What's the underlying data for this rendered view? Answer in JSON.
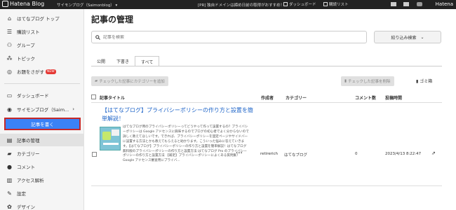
{
  "topbar": {
    "logo": "Hatena Blog",
    "blog_name": "サイモンブログ（Saimonblog） ▾",
    "promo": "[PR] 独自ドメインは締め日前の取得がおすすめ！",
    "dashboard": "ダッシュボード",
    "reading_list": "購読リスト",
    "brand": "Hatena"
  },
  "sidebar": {
    "items": [
      {
        "label": "はてなブログ トップ",
        "icon": "house-icon"
      },
      {
        "label": "購読リスト",
        "icon": "list-icon"
      },
      {
        "label": "グループ",
        "icon": "group-icon"
      },
      {
        "label": "トピック",
        "icon": "topic-icon"
      },
      {
        "label": "お題をさがす",
        "icon": "search-topic-icon",
        "badge": "NEW"
      }
    ],
    "dashboard": "ダッシュボード",
    "blog_selector": "サイモンブログ（Saim...",
    "write_button": "記事を書く",
    "items2": [
      {
        "label": "記事の管理",
        "icon": "doc-icon"
      },
      {
        "label": "カテゴリー",
        "icon": "folder-icon"
      },
      {
        "label": "コメント",
        "icon": "comment-icon"
      },
      {
        "label": "アクセス解析",
        "icon": "chart-icon"
      },
      {
        "label": "設定",
        "icon": "wrench-icon"
      },
      {
        "label": "デザイン",
        "icon": "palette-icon"
      }
    ]
  },
  "main": {
    "title": "記事の管理",
    "search_placeholder": "記事を検索",
    "filter_label": "絞り込み検索",
    "tabs": [
      "公開",
      "下書き",
      "すべて"
    ],
    "add_category_btn": "チェックした記事にカテゴリーを追加",
    "delete_btn": "チェックした記事を削除",
    "trash_label": "ゴミ箱",
    "columns": {
      "title": "記事タイトル",
      "author": "作成者",
      "category": "カテゴリー",
      "comments": "コメント数",
      "posted": "投稿時間"
    },
    "row": {
      "title": "【はてなブログ】プライバシーポリシーの作り方と設置を簡単解説！",
      "excerpt": "はてなブログ用のプライバシーポリシーってどうやって作って設置するの？プライバシーポリシーは Google アドセンスに興味するのでブログの初心者でよく分からないので詳しく教えてほしいです。できれば、プライバシーポリシーを固定ページやサイドバーに設置する方法とかも教えてもらえると助かります。こういった悩みに答えていきます。【はてなブログ】プライバシーポリシーの作り方と設置を簡単解説！はてなブログ無料版のプライバシーポリシーの作り方と設置方法 はてなブログ Pro のプライバシーポリシーの作り方と設置方法 【補足】プライバシーポリシーによくある質問集！ Google アドセンス審査用にプライバ...",
      "more": "•••",
      "author": "retirerich",
      "category": "はてなブログ",
      "comments": "0",
      "posted": "2023/4/13 8:22:47"
    }
  }
}
